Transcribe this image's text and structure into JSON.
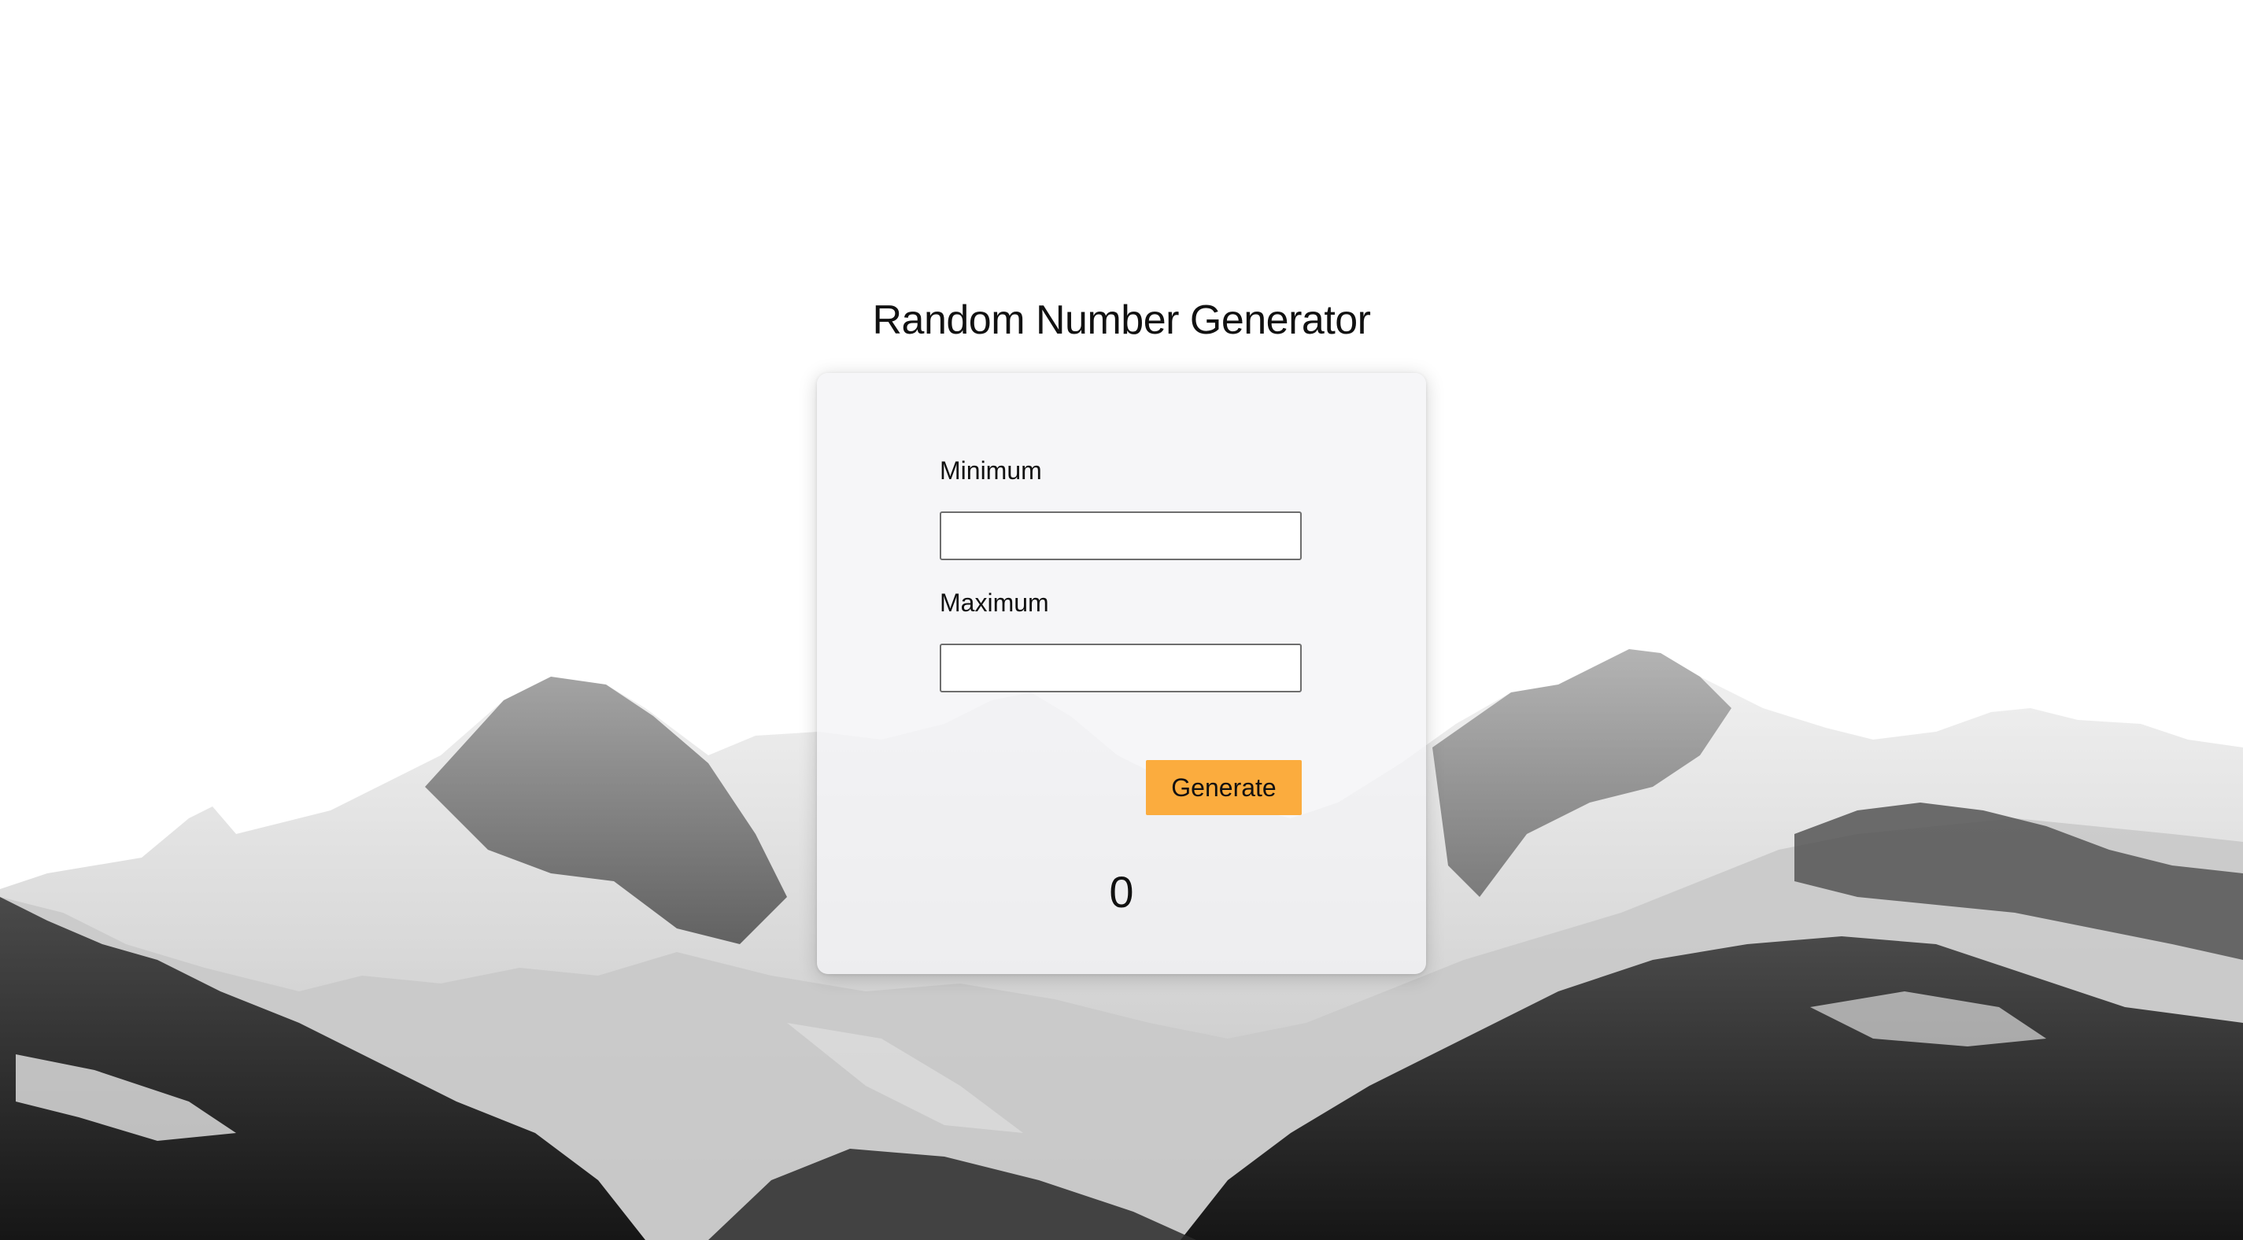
{
  "app": {
    "title": "Random Number Generator"
  },
  "form": {
    "minimum_label": "Minimum",
    "minimum_value": "",
    "minimum_placeholder": "",
    "maximum_label": "Maximum",
    "maximum_value": "",
    "maximum_placeholder": "",
    "generate_label": "Generate",
    "result": "0"
  },
  "colors": {
    "accent": "#fbac3e",
    "card_background": "#f4f4f6",
    "text": "#111111",
    "background": "#ffffff"
  }
}
